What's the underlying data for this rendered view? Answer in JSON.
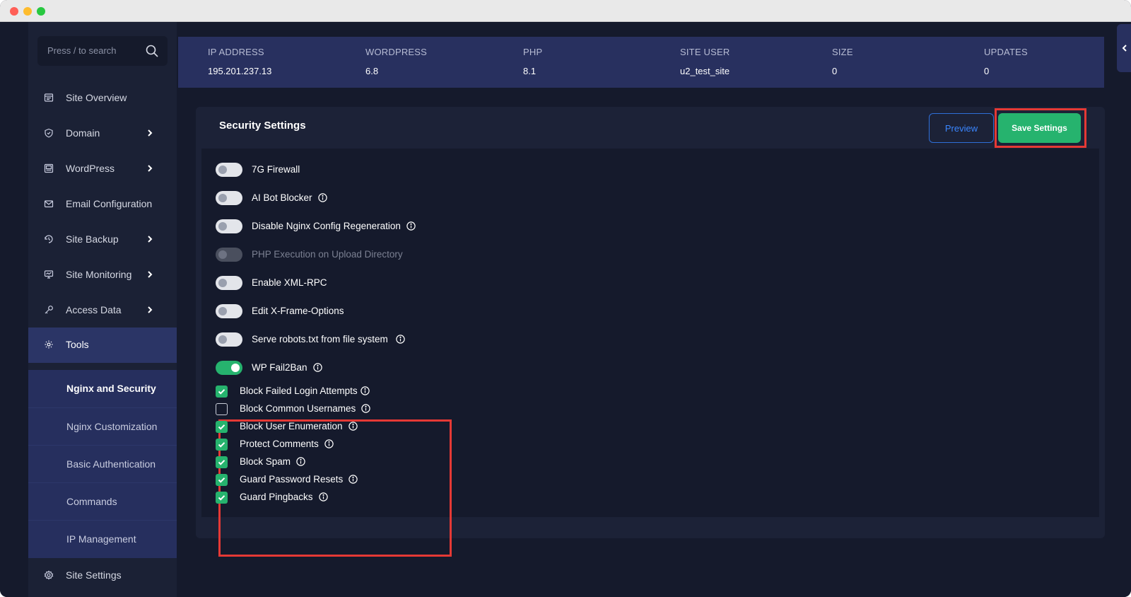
{
  "sidebar": {
    "search_placeholder": "Press / to search",
    "items": [
      {
        "label": "Site Overview",
        "icon": "overview-icon",
        "has_chevron": false
      },
      {
        "label": "Domain",
        "icon": "shield-icon",
        "has_chevron": true
      },
      {
        "label": "WordPress",
        "icon": "wordpress-icon",
        "has_chevron": true
      },
      {
        "label": "Email Configuration",
        "icon": "mail-icon",
        "has_chevron": false
      },
      {
        "label": "Site Backup",
        "icon": "backup-icon",
        "has_chevron": true
      },
      {
        "label": "Site Monitoring",
        "icon": "monitor-icon",
        "has_chevron": true
      },
      {
        "label": "Access Data",
        "icon": "key-icon",
        "has_chevron": true
      },
      {
        "label": "Tools",
        "icon": "tools-icon",
        "has_chevron": false,
        "active": true
      }
    ],
    "sub_items": [
      {
        "label": "Nginx and Security",
        "active": true
      },
      {
        "label": "Nginx Customization"
      },
      {
        "label": "Basic Authentication"
      },
      {
        "label": "Commands"
      },
      {
        "label": "IP Management"
      }
    ],
    "footer_item": {
      "label": "Site Settings",
      "icon": "gear-icon"
    }
  },
  "info_bar": {
    "columns": [
      {
        "header": "IP ADDRESS",
        "value": "195.201.237.13"
      },
      {
        "header": "WORDPRESS",
        "value": "6.8"
      },
      {
        "header": "PHP",
        "value": "8.1"
      },
      {
        "header": "SITE USER",
        "value": "u2_test_site"
      },
      {
        "header": "SIZE",
        "value": "0"
      },
      {
        "header": "UPDATES",
        "value": "0"
      }
    ]
  },
  "card": {
    "title": "Security Settings",
    "preview_label": "Preview",
    "save_label": "Save Settings",
    "toggles": [
      {
        "label": "7G Firewall",
        "state": "off",
        "info": false
      },
      {
        "label": "AI Bot Blocker",
        "state": "off",
        "info": true
      },
      {
        "label": "Disable Nginx Config Regeneration",
        "state": "off",
        "info": true
      },
      {
        "label": "PHP Execution on Upload Directory",
        "state": "disabled",
        "info": false
      },
      {
        "label": "Enable XML-RPC",
        "state": "off",
        "info": false
      },
      {
        "label": "Edit X-Frame-Options",
        "state": "off",
        "info": false
      },
      {
        "label": "Serve robots.txt from file system",
        "state": "off",
        "info": true
      },
      {
        "label": "WP Fail2Ban",
        "state": "on",
        "info": true
      }
    ],
    "checkboxes": [
      {
        "label": "Block Failed Login Attempts",
        "checked": true
      },
      {
        "label": "Block Common Usernames",
        "checked": false
      },
      {
        "label": "Block User Enumeration",
        "checked": true
      },
      {
        "label": "Protect Comments",
        "checked": true
      },
      {
        "label": "Block Spam",
        "checked": true
      },
      {
        "label": "Guard Password Resets",
        "checked": true
      },
      {
        "label": "Guard Pingbacks",
        "checked": true
      }
    ]
  },
  "colors": {
    "accent_green": "#26b36e",
    "accent_blue": "#3a86ff",
    "highlight_red": "#e53935",
    "background": "#151a2c"
  }
}
